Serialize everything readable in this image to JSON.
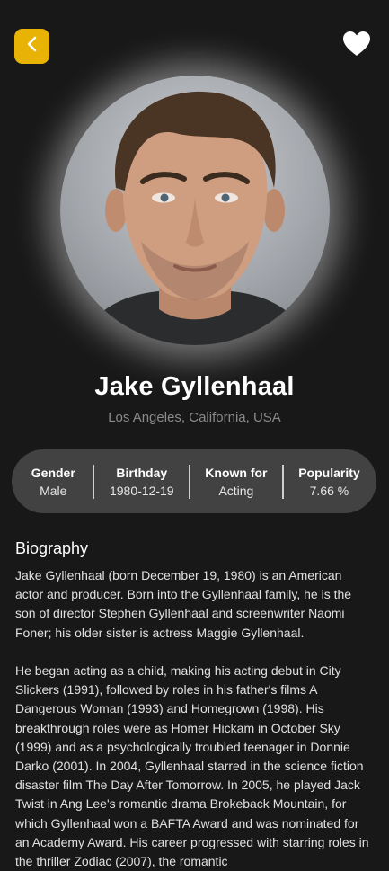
{
  "header": {
    "back_icon": "chevron-left-icon",
    "favorite_icon": "heart-icon",
    "accent_color": "#e9b306"
  },
  "profile": {
    "name": "Jake Gyllenhaal",
    "place_of_birth": "Los Angeles, California, USA",
    "photo_alt": "Jake Gyllenhaal portrait"
  },
  "stats": [
    {
      "label": "Gender",
      "value": "Male"
    },
    {
      "label": "Birthday",
      "value": "1980-12-19"
    },
    {
      "label": "Known for",
      "value": "Acting"
    },
    {
      "label": "Popularity",
      "value": "7.66 %"
    }
  ],
  "biography": {
    "title": "Biography",
    "text": "Jake Gyllenhaal (born December 19, 1980) is an American actor and producer. Born into the Gyllenhaal family, he is the son of director Stephen Gyllenhaal and screenwriter Naomi Foner; his older sister is actress Maggie Gyllenhaal.\n\nHe began acting as a child, making his acting debut in City Slickers (1991), followed by roles in his father's films A Dangerous Woman (1993) and Homegrown (1998). His breakthrough roles were as Homer Hickam in October Sky (1999) and as a psychologically troubled teenager in Donnie Darko (2001).  In 2004, Gyllenhaal starred in the science fiction disaster film The Day After Tomorrow. In 2005, he played Jack Twist in Ang Lee's romantic drama Brokeback Mountain, for which Gyllenhaal won a BAFTA Award and was nominated for an Academy Award. His career progressed with starring roles in the thriller Zodiac (2007), the romantic"
  }
}
